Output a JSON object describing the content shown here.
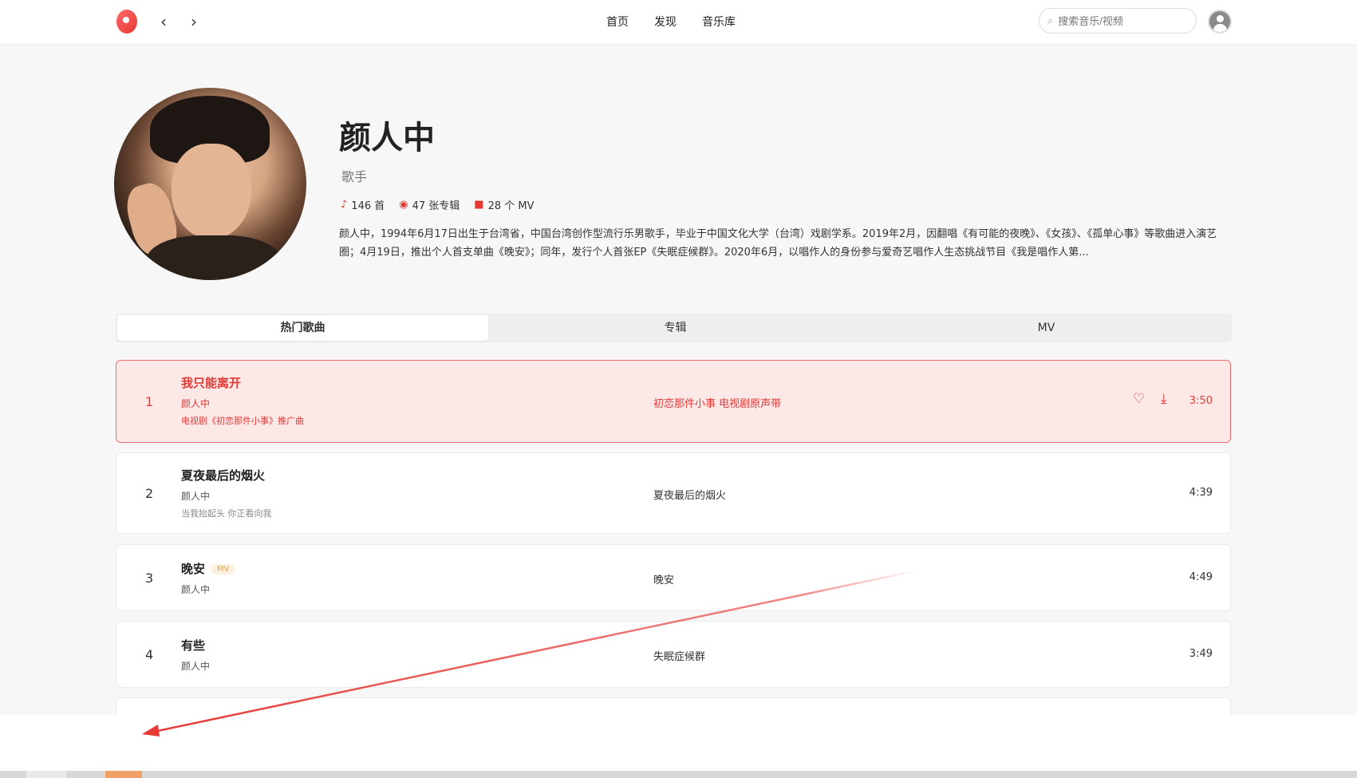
{
  "nav": {
    "back_icon": "chevron-left-icon",
    "forward_icon": "chevron-right-icon",
    "links": [
      "首页",
      "发现",
      "音乐库"
    ]
  },
  "search": {
    "placeholder": "搜索音乐/视频"
  },
  "artist": {
    "name": "颜人中",
    "role": "歌手",
    "song_count": "146 首",
    "album_count": "47 张专辑",
    "mv_count": "28 个 MV",
    "bio": "颜人中，1994年6月17日出生于台湾省，中国台湾创作型流行乐男歌手，毕业于中国文化大学（台湾）戏剧学系。2019年2月，因翻唱《有可能的夜晚》、《女孩》、《孤单心事》等歌曲进入演艺圈；4月19日，推出个人首支单曲《晚安》；同年，发行个人首张EP《失眠症候群》。2020年6月，以唱作人的身份参与爱奇艺唱作人生态挑战节目《我是唱作人第..."
  },
  "tabs": [
    "热门歌曲",
    "专辑",
    "MV"
  ],
  "songs": [
    {
      "num": "1",
      "title": "我只能离开",
      "artist": "颜人中",
      "sub": "电视剧《初恋那件小事》推广曲",
      "album": "初恋那件小事 电视剧原声带",
      "duration": "3:50"
    },
    {
      "num": "2",
      "title": "夏夜最后的烟火",
      "artist": "颜人中",
      "sub": "当我抬起头 你正看向我",
      "album": "夏夜最后的烟火",
      "duration": "4:39"
    },
    {
      "num": "3",
      "title": "晚安",
      "badge": "MV",
      "artist": "颜人中",
      "album": "晚安",
      "duration": "4:49"
    },
    {
      "num": "4",
      "title": "有些",
      "artist": "颜人中",
      "album": "失眠症候群",
      "duration": "3:49"
    }
  ],
  "colors": {
    "accent": "#e53935",
    "active_row_bg": "#fde8e8",
    "mv_badge": "#e8a24a"
  }
}
